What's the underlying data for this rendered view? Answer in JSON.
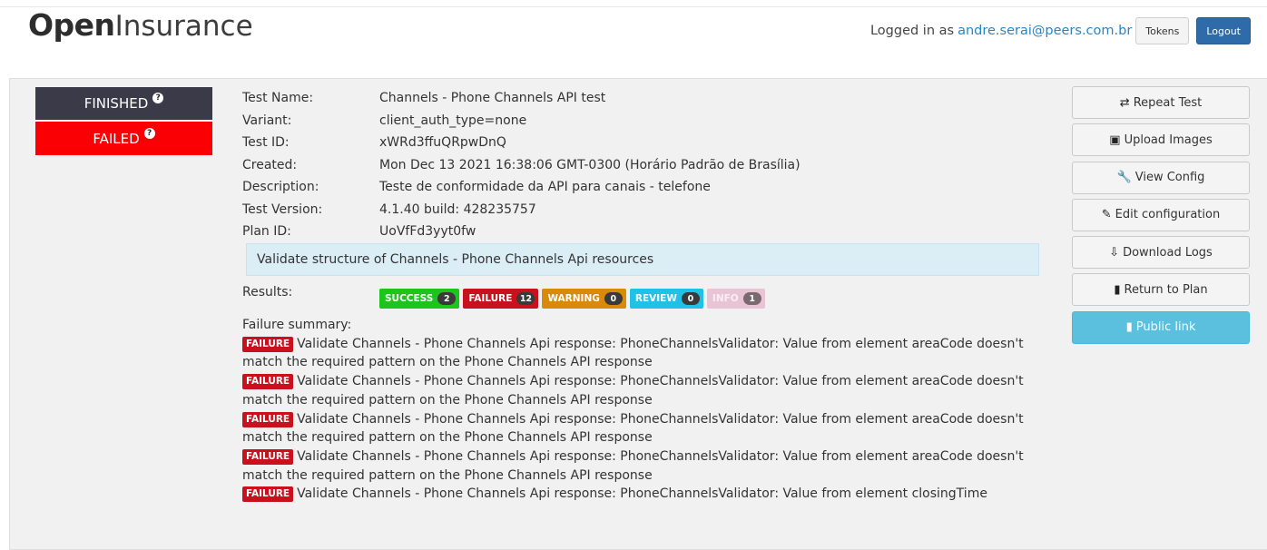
{
  "brand": {
    "bold": "Open",
    "light": "Insurance"
  },
  "header": {
    "logged_in_prefix": "Logged in as",
    "user_email": "andre.serai@peers.com.br",
    "tokens_label": "Tokens",
    "logout_label": "Logout"
  },
  "status": {
    "finished": "FINISHED",
    "failed": "FAILED",
    "help_glyph": "?"
  },
  "test_info": [
    {
      "label": "Test Name:",
      "value": "Channels - Phone Channels API test"
    },
    {
      "label": "Variant:",
      "value": "client_auth_type=none"
    },
    {
      "label": "Test ID:",
      "value": "xWRd3ffuQRpwDnQ"
    },
    {
      "label": "Created:",
      "value": "Mon Dec 13 2021 16:38:06 GMT-0300 (Horário Padrão de Brasília)"
    },
    {
      "label": "Description:",
      "value": "Teste de conformidade da API para canais - telefone"
    },
    {
      "label": "Test Version:",
      "value": "4.1.40 build: 428235757"
    },
    {
      "label": "Plan ID:",
      "value": "UoVfFd3yyt0fw"
    }
  ],
  "callout": "Validate structure of Channels - Phone Channels Api resources",
  "results": {
    "label": "Results:",
    "badges": [
      {
        "label": "SUCCESS",
        "count": "2",
        "color": "#1cc41c"
      },
      {
        "label": "FAILURE",
        "count": "12",
        "color": "#c9111d"
      },
      {
        "label": "WARNING",
        "count": "0",
        "color": "#d98a08"
      },
      {
        "label": "REVIEW",
        "count": "0",
        "color": "#1fc1e6"
      },
      {
        "label": "INFO",
        "count": "1",
        "color": "#e8c4d4"
      }
    ]
  },
  "failure_summary": {
    "label": "Failure summary:",
    "tag": "FAILURE",
    "entries": [
      "Validate Channels - Phone Channels Api response: PhoneChannelsValidator: Value from element areaCode doesn't match the required pattern on the Phone Channels API response",
      "Validate Channels - Phone Channels Api response: PhoneChannelsValidator: Value from element areaCode doesn't match the required pattern on the Phone Channels API response",
      "Validate Channels - Phone Channels Api response: PhoneChannelsValidator: Value from element areaCode doesn't match the required pattern on the Phone Channels API response",
      "Validate Channels - Phone Channels Api response: PhoneChannelsValidator: Value from element areaCode doesn't match the required pattern on the Phone Channels API response",
      "Validate Channels - Phone Channels Api response: PhoneChannelsValidator: Value from element closingTime"
    ]
  },
  "actions": [
    {
      "label": "Repeat Test",
      "icon": "repeat-icon",
      "glyph": "⇄"
    },
    {
      "label": "Upload Images",
      "icon": "image-icon",
      "glyph": "▣"
    },
    {
      "label": "View Config",
      "icon": "wrench-icon",
      "glyph": "🔧"
    },
    {
      "label": "Edit configuration",
      "icon": "edit-icon",
      "glyph": "✎"
    },
    {
      "label": "Download Logs",
      "icon": "download-file-icon",
      "glyph": "⇩"
    },
    {
      "label": "Return to Plan",
      "icon": "book-icon",
      "glyph": "▮"
    },
    {
      "label": "Public link",
      "icon": "public-book-icon",
      "glyph": "▮"
    }
  ]
}
